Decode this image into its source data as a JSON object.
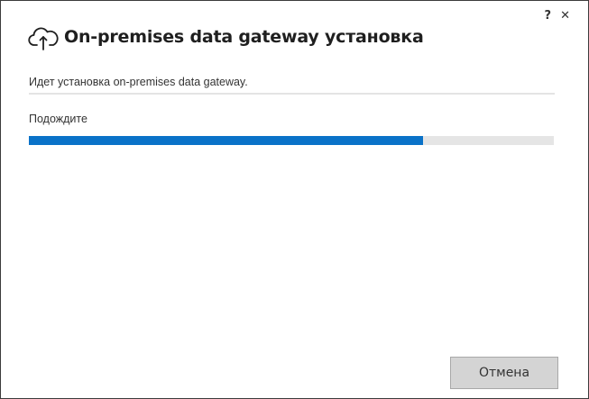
{
  "window": {
    "help_label": "?",
    "close_label": "✕"
  },
  "header": {
    "icon": "cloud-upload-icon",
    "title": "On-premises data gateway установка"
  },
  "main": {
    "status_text": "Идет установка on-premises data gateway.",
    "wait_text": "Подождите",
    "progress": 0.75,
    "progress_color": "#0a72c8",
    "track_color": "#e5e5e5"
  },
  "footer": {
    "cancel_label": "Отмена"
  }
}
